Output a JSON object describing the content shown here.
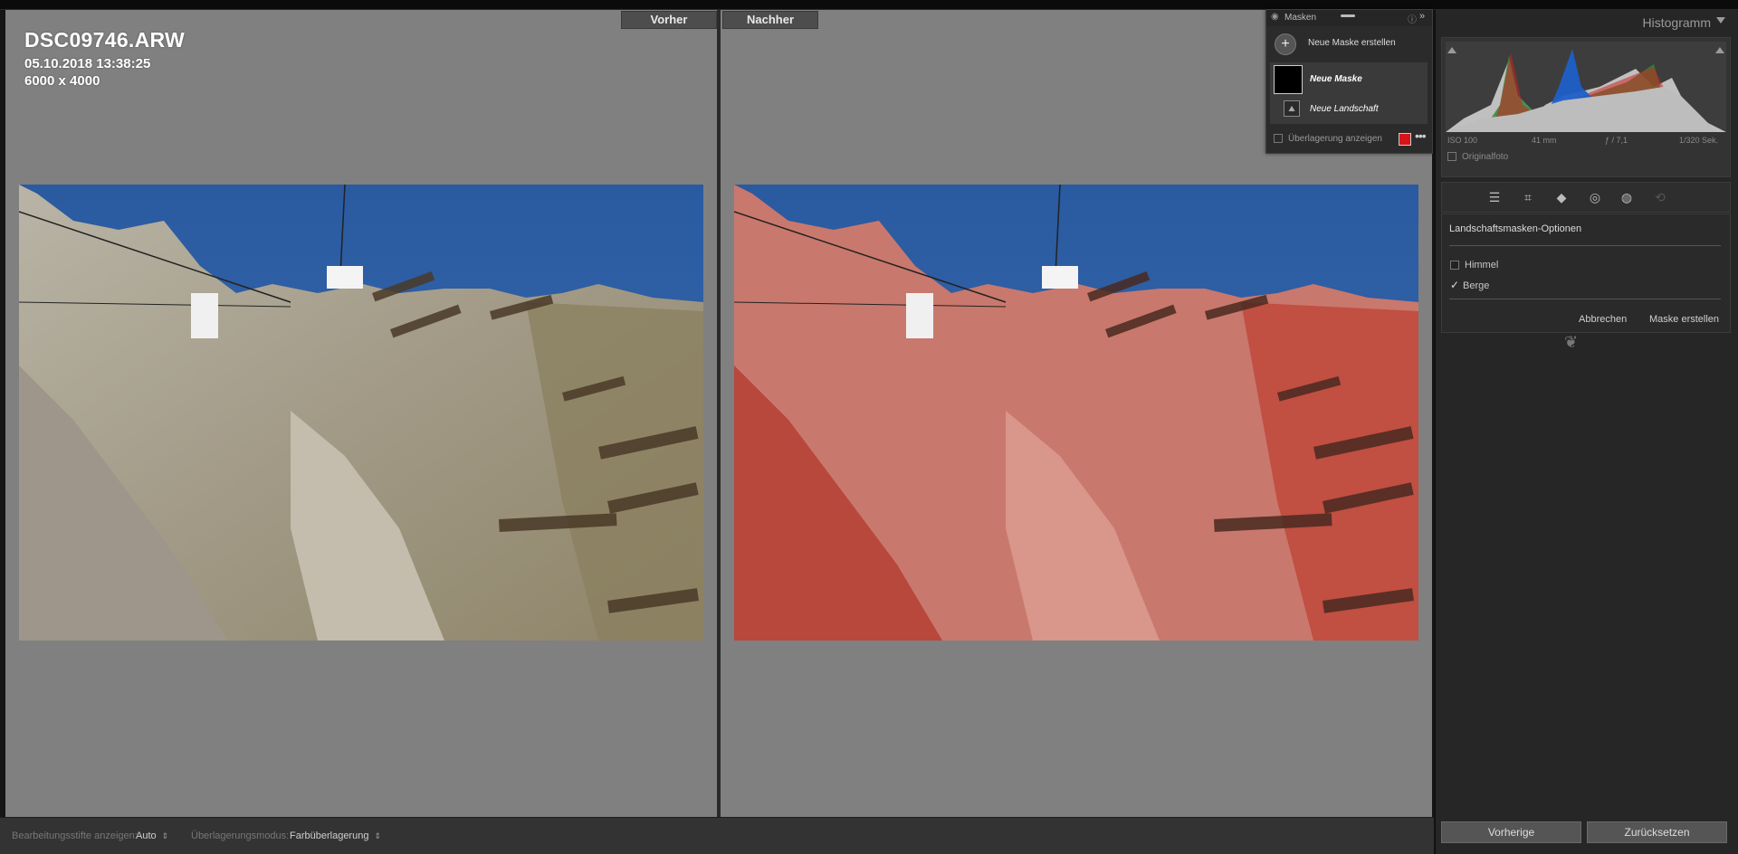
{
  "compare": {
    "before_label": "Vorher",
    "after_label": "Nachher",
    "file_name": "DSC09746.ARW",
    "datetime": "05.10.2018 13:38:25",
    "dimensions": "6000 x 4000"
  },
  "photo": {
    "description_icon": "mountain-cable-car-photo",
    "overlay_color": "#e0211f"
  },
  "masks_panel": {
    "title": "Masken",
    "create_label": "Neue Maske erstellen",
    "mask_name": "Neue Maske",
    "component_name": "Neue Landschaft",
    "overlay_label": "Überlagerung anzeigen",
    "overlay_color": "#d8141b"
  },
  "histogram": {
    "title": "Histogramm",
    "iso": "ISO 100",
    "focal": "41 mm",
    "aperture": "ƒ / 7,1",
    "shutter": "1/320 Sek.",
    "original_label": "Originalfoto"
  },
  "landscape_options": {
    "title": "Landschaftsmasken-Optionen",
    "option_sky": "Himmel",
    "option_sky_checked": false,
    "option_mountains": "Berge",
    "option_mountains_checked": true,
    "cancel_label": "Abbrechen",
    "create_label": "Maske erstellen"
  },
  "toolbar": {
    "pins_label": "Bearbeitungsstifte anzeigen:",
    "pins_value": "Auto",
    "overlay_mode_label": "Überlagerungsmodus:",
    "overlay_mode_value": "Farbüberlagerung"
  },
  "footer_buttons": {
    "previous": "Vorherige",
    "reset": "Zurücksetzen"
  }
}
